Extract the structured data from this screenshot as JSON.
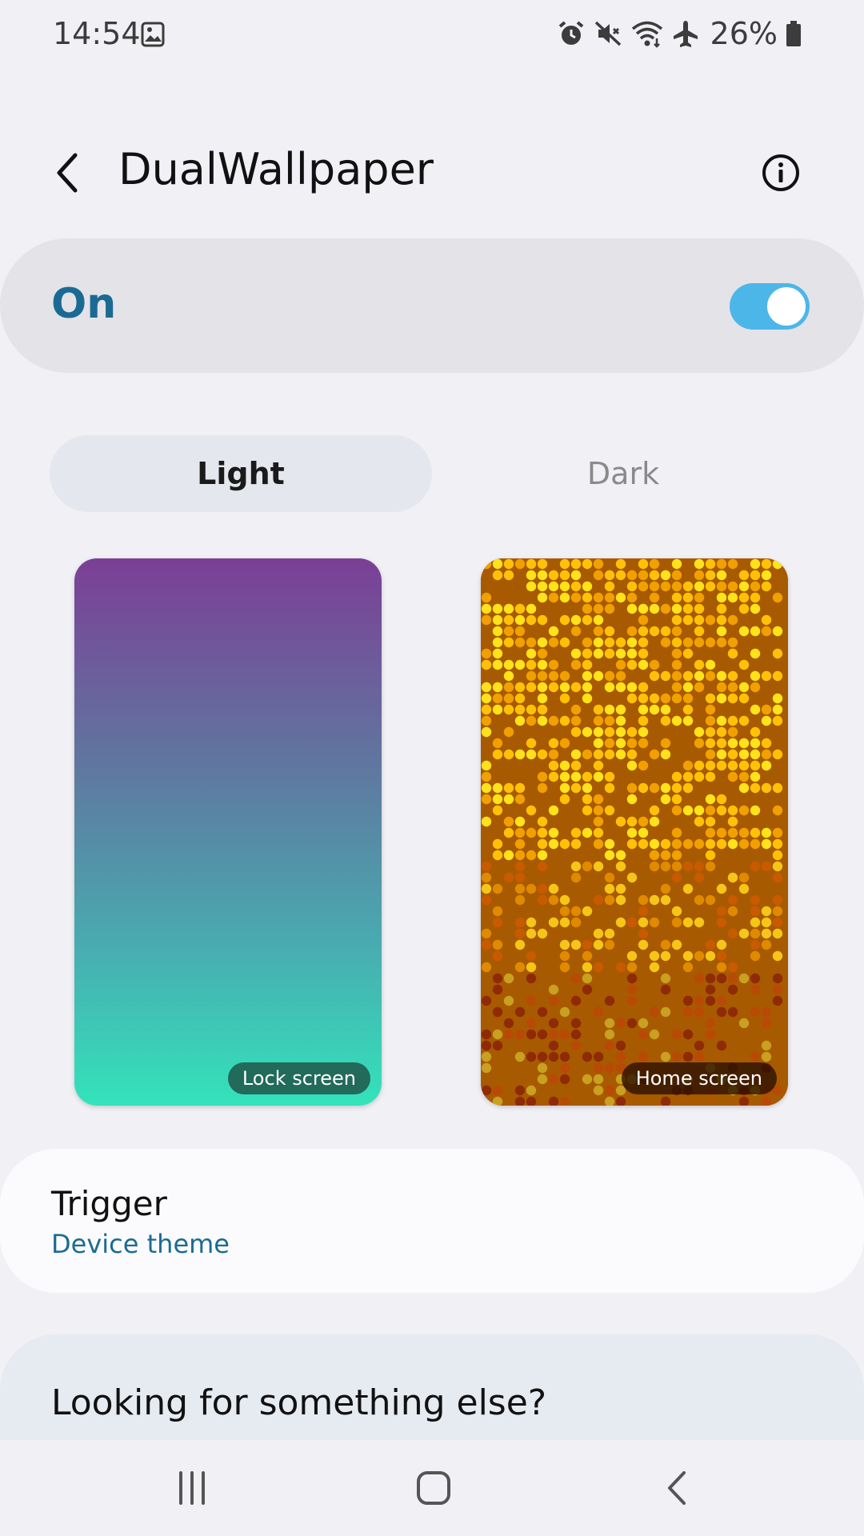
{
  "status_bar": {
    "time": "14:54",
    "battery": "26%",
    "icons": [
      "gallery-icon",
      "alarm-icon",
      "mute-icon",
      "wifi-icon",
      "airplane-icon",
      "battery-icon"
    ]
  },
  "header": {
    "title": "DualWallpaper",
    "back_icon": "back-arrow-icon",
    "info_icon": "info-icon"
  },
  "master_switch": {
    "label": "On",
    "checked": true
  },
  "tabs": [
    {
      "label": "Light",
      "selected": true
    },
    {
      "label": "Dark",
      "selected": false
    }
  ],
  "previews": {
    "lock": {
      "label": "Lock screen"
    },
    "home": {
      "label": "Home screen"
    }
  },
  "trigger": {
    "title": "Trigger",
    "value": "Device theme"
  },
  "looking": {
    "text": "Looking for something else?"
  },
  "navbar": {
    "icons": [
      "recents-icon",
      "home-icon",
      "back-icon"
    ]
  },
  "colors": {
    "accent": "#1a6b93",
    "toggle_on": "#4db6e9"
  }
}
